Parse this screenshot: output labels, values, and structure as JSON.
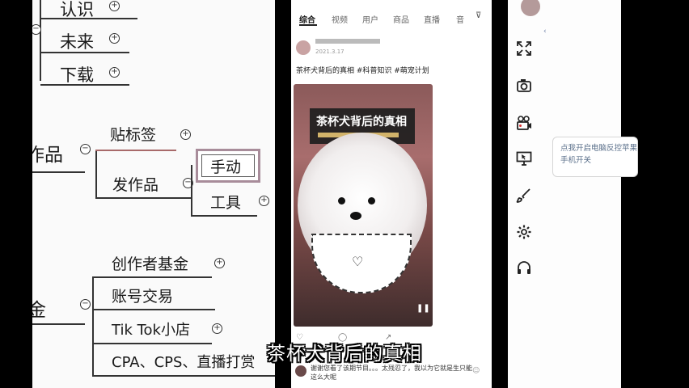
{
  "mindmap": {
    "node_renshi": "认识",
    "node_weilai": "未来",
    "node_xiazai": "下载",
    "node_zuopin": "作品",
    "node_tiebiaoqian": "贴标签",
    "node_fazuopin": "发作品",
    "node_shoudong": "手动",
    "node_gongju": "工具",
    "node_jijin_partial": "金",
    "node_chuangzuozhe": "创作者基金",
    "node_zhanghao": "账号交易",
    "node_tiktok": "Tik Tok小店",
    "node_cpa": "CPA、CPS、直播打赏"
  },
  "phone": {
    "tabs": [
      "综合",
      "视频",
      "用户",
      "商品",
      "直播",
      "音"
    ],
    "post_date": "2021.3.17",
    "post_caption": "茶杯犬背后的真相 #科普知识 #萌宠计划",
    "video_title": "茶杯犬背后的真相",
    "comment_text": "谢谢您看了该期节目。。。太残忍了，我以为它就是生只能这么大呢"
  },
  "panel": {
    "tooltip_text": "点我开启电脑反控苹果手机开关",
    "icons": [
      "fullscreen-icon",
      "camera-icon",
      "video-record-icon",
      "computer-control-icon",
      "brush-icon",
      "settings-icon",
      "headset-icon"
    ]
  },
  "subtitle": "茶杯犬背后的真相"
}
